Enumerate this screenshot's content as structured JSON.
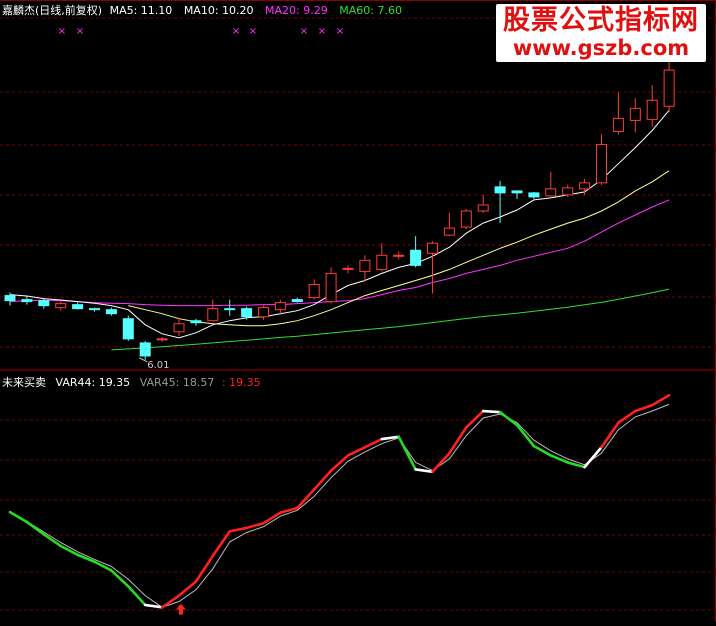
{
  "header_top": {
    "name": "嘉麟杰(日线,前复权)",
    "items": [
      {
        "label": "MA5: 11.10",
        "color": "#ffffff"
      },
      {
        "label": "MA10: 10.20",
        "color": "#ffffff"
      },
      {
        "label": "MA20: 9.29",
        "color": "#ff00ff"
      },
      {
        "label": "MA60: 7.60",
        "color": "#00ff00"
      }
    ]
  },
  "header_bottom": {
    "name": "未来买卖",
    "items": [
      {
        "label": "VAR44: 19.35",
        "color": "#ffffff"
      },
      {
        "label": "VAR45: 18.57",
        "color": "#aaaaaa"
      },
      {
        "label": ": 19.35",
        "color": "#ff2020"
      }
    ]
  },
  "watermark": {
    "line1": "股票公式指标网",
    "line2": "www.gszb.com"
  },
  "colors": {
    "up": "#ff3b3b",
    "down": "#54ffff",
    "ma5": "#ffffff",
    "ma10": "#ffff99",
    "ma20": "#ff33ff",
    "ma60": "#33dd33",
    "grid": "#7a0000"
  },
  "chart_data": [
    {
      "type": "candlestick",
      "annotation": {
        "text": "6.01"
      },
      "candles": [
        {
          "o": 9.2,
          "c": 8.95,
          "h": 9.35,
          "l": 8.7
        },
        {
          "o": 9.0,
          "c": 8.9,
          "h": 9.15,
          "l": 8.75
        },
        {
          "o": 8.95,
          "c": 8.7,
          "h": 9.05,
          "l": 8.55
        },
        {
          "o": 8.6,
          "c": 8.8,
          "h": 8.9,
          "l": 8.45
        },
        {
          "o": 8.75,
          "c": 8.55,
          "h": 8.85,
          "l": 8.5
        },
        {
          "o": 8.55,
          "c": 8.5,
          "h": 8.6,
          "l": 8.4
        },
        {
          "o": 8.5,
          "c": 8.3,
          "h": 8.6,
          "l": 8.2
        },
        {
          "o": 8.05,
          "c": 7.05,
          "h": 8.2,
          "l": 6.95
        },
        {
          "o": 6.85,
          "c": 6.2,
          "h": 6.95,
          "l": 6.01
        },
        {
          "o": 7.0,
          "c": 7.05,
          "h": 7.15,
          "l": 6.9
        },
        {
          "o": 7.4,
          "c": 7.8,
          "h": 8.1,
          "l": 7.2
        },
        {
          "o": 7.95,
          "c": 7.85,
          "h": 8.05,
          "l": 7.7
        },
        {
          "o": 7.95,
          "c": 8.55,
          "h": 9.0,
          "l": 7.95
        },
        {
          "o": 8.55,
          "c": 8.5,
          "h": 9.0,
          "l": 8.2
        },
        {
          "o": 8.55,
          "c": 8.15,
          "h": 8.65,
          "l": 8.0
        },
        {
          "o": 8.15,
          "c": 8.6,
          "h": 8.7,
          "l": 8.0
        },
        {
          "o": 8.5,
          "c": 8.85,
          "h": 9.0,
          "l": 8.3
        },
        {
          "o": 9.0,
          "c": 8.9,
          "h": 9.1,
          "l": 8.85
        },
        {
          "o": 9.1,
          "c": 9.75,
          "h": 10.0,
          "l": 9.0
        },
        {
          "o": 8.9,
          "c": 10.3,
          "h": 10.6,
          "l": 8.8
        },
        {
          "o": 10.5,
          "c": 10.55,
          "h": 10.7,
          "l": 10.3
        },
        {
          "o": 10.4,
          "c": 10.95,
          "h": 11.2,
          "l": 9.9
        },
        {
          "o": 10.5,
          "c": 11.2,
          "h": 11.8,
          "l": 10.4
        },
        {
          "o": 11.15,
          "c": 11.2,
          "h": 11.4,
          "l": 11.0
        },
        {
          "o": 11.45,
          "c": 10.7,
          "h": 12.15,
          "l": 10.6
        },
        {
          "o": 11.3,
          "c": 11.8,
          "h": 11.9,
          "l": 9.3
        },
        {
          "o": 12.2,
          "c": 12.55,
          "h": 13.3,
          "l": 12.15
        },
        {
          "o": 12.6,
          "c": 13.4,
          "h": 13.5,
          "l": 12.5
        },
        {
          "o": 13.4,
          "c": 13.7,
          "h": 14.2,
          "l": 13.3
        },
        {
          "o": 14.6,
          "c": 14.3,
          "h": 14.9,
          "l": 12.8
        },
        {
          "o": 14.4,
          "c": 14.3,
          "h": 14.4,
          "l": 14.0
        },
        {
          "o": 14.3,
          "c": 14.1,
          "h": 14.35,
          "l": 14.0
        },
        {
          "o": 14.15,
          "c": 14.5,
          "h": 15.35,
          "l": 14.1
        },
        {
          "o": 14.2,
          "c": 14.55,
          "h": 14.7,
          "l": 14.1
        },
        {
          "o": 14.5,
          "c": 14.8,
          "h": 15.0,
          "l": 14.2
        },
        {
          "o": 14.8,
          "c": 16.7,
          "h": 17.2,
          "l": 14.7
        },
        {
          "o": 17.35,
          "c": 18.0,
          "h": 19.3,
          "l": 17.2
        },
        {
          "o": 17.9,
          "c": 18.5,
          "h": 19.0,
          "l": 17.3
        },
        {
          "o": 17.95,
          "c": 18.9,
          "h": 19.65,
          "l": 17.6
        },
        {
          "o": 18.6,
          "c": 20.4,
          "h": 20.9,
          "l": 18.3
        }
      ],
      "ma5": [
        9.25,
        9.18,
        9.05,
        8.98,
        8.9,
        8.82,
        8.7,
        8.5,
        7.75,
        7.3,
        7.1,
        7.35,
        7.75,
        7.95,
        8.1,
        8.15,
        8.3,
        8.45,
        8.75,
        9.25,
        9.7,
        9.95,
        10.3,
        10.6,
        10.8,
        11.15,
        11.6,
        12.3,
        12.8,
        13.1,
        13.45,
        13.95,
        14.05,
        14.2,
        14.35,
        14.95,
        15.75,
        16.55,
        17.4,
        18.4
      ],
      "ma10": [
        null,
        null,
        null,
        null,
        null,
        null,
        null,
        8.7,
        8.5,
        8.3,
        8.05,
        7.9,
        7.8,
        7.75,
        7.7,
        7.7,
        7.8,
        7.95,
        8.2,
        8.5,
        8.85,
        9.2,
        9.45,
        9.7,
        9.95,
        10.2,
        10.5,
        10.85,
        11.2,
        11.55,
        11.85,
        12.2,
        12.5,
        12.8,
        13.05,
        13.4,
        13.85,
        14.4,
        14.85,
        15.4
      ],
      "ma20": [
        8.9,
        8.95,
        8.97,
        8.95,
        8.9,
        8.85,
        8.82,
        8.8,
        8.75,
        8.72,
        8.7,
        8.7,
        8.7,
        8.72,
        8.72,
        8.75,
        8.75,
        8.8,
        8.85,
        8.9,
        8.95,
        9.05,
        9.25,
        9.45,
        9.6,
        9.85,
        10.05,
        10.3,
        10.5,
        10.7,
        10.95,
        11.15,
        11.35,
        11.55,
        11.9,
        12.35,
        12.8,
        13.2,
        13.6,
        13.95
      ],
      "ma60": [
        null,
        null,
        null,
        null,
        null,
        null,
        6.5,
        6.55,
        6.6,
        6.66,
        6.72,
        6.78,
        6.85,
        6.92,
        6.98,
        7.05,
        7.12,
        7.18,
        7.26,
        7.34,
        7.42,
        7.5,
        7.58,
        7.66,
        7.76,
        7.86,
        7.96,
        8.06,
        8.16,
        8.24,
        8.32,
        8.42,
        8.52,
        8.62,
        8.74,
        8.86,
        9.02,
        9.18,
        9.34,
        9.52
      ]
    },
    {
      "type": "line",
      "var44": [
        9.35,
        8.5,
        7.45,
        6.45,
        5.7,
        5.1,
        4.35,
        3.0,
        1.4,
        1.2,
        2.2,
        3.4,
        5.6,
        7.7,
        8.0,
        8.4,
        9.3,
        9.7,
        11.3,
        12.9,
        14.2,
        14.9,
        15.6,
        15.8,
        13.0,
        12.8,
        14.4,
        16.6,
        18.0,
        17.9,
        16.8,
        15.0,
        14.2,
        13.6,
        13.2,
        14.9,
        17.0,
        18.0,
        18.5,
        19.35
      ],
      "var45": [
        9.3,
        8.55,
        7.65,
        6.75,
        5.95,
        5.3,
        4.7,
        3.6,
        2.2,
        1.2,
        1.7,
        2.7,
        4.5,
        6.8,
        7.6,
        8.1,
        9.0,
        9.5,
        10.7,
        12.3,
        13.7,
        14.5,
        15.2,
        15.7,
        13.6,
        12.9,
        13.9,
        15.9,
        17.4,
        17.75,
        17.0,
        15.5,
        14.6,
        13.9,
        13.4,
        14.4,
        16.4,
        17.5,
        18.0,
        18.57
      ],
      "signals": [
        "down",
        "down",
        "down",
        "down",
        "down",
        "down",
        "down",
        "down",
        "down",
        "flat",
        "up",
        "up",
        "up",
        "up",
        "up",
        "up",
        "up",
        "up",
        "up",
        "up",
        "up",
        "up",
        "up",
        "flat",
        "down",
        "flat",
        "up",
        "up",
        "up",
        "flat",
        "down",
        "down",
        "down",
        "down",
        "down",
        "flat",
        "up",
        "up",
        "up",
        "up"
      ],
      "buy_marker_index": 10
    }
  ]
}
